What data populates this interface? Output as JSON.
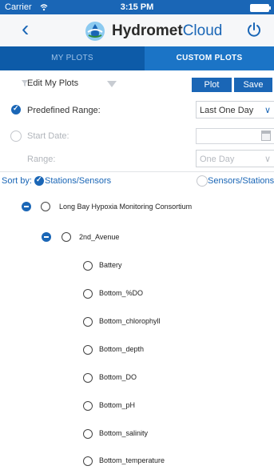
{
  "status_bar": {
    "carrier": "Carrier",
    "time": "3:15 PM"
  },
  "nav": {
    "back_icon": "chevron-left-icon",
    "brand_bold": "Hydromet",
    "brand_light": "Cloud",
    "power_icon": "power-icon"
  },
  "tabs": [
    {
      "label": "MY PLOTS"
    },
    {
      "label": "CUSTOM PLOTS"
    }
  ],
  "toolbar": {
    "edit_label": "Edit My Plots",
    "plot_label": "Plot",
    "save_label": "Save"
  },
  "range": {
    "predefined_label": "Predefined Range:",
    "predefined_value": "Last One Day",
    "start_date_label": "Start Date:",
    "start_date_value": "",
    "range_label": "Range:",
    "range_value": "One Day"
  },
  "sort": {
    "label": "Sort by:",
    "option1": "Stations/Sensors",
    "option2": "Sensors/Stations"
  },
  "tree": {
    "root": "Long Bay Hypoxia Monitoring Consortium",
    "station": "2nd_Avenue",
    "sensors": [
      "Battery",
      "Bottom_%DO",
      "Bottom_chlorophyll",
      "Bottom_depth",
      "Bottom_DO",
      "Bottom_pH",
      "Bottom_salinity",
      "Bottom_temperature"
    ]
  },
  "colors": {
    "primary": "#1a66b6",
    "tab_dark": "#0d5ba8"
  }
}
